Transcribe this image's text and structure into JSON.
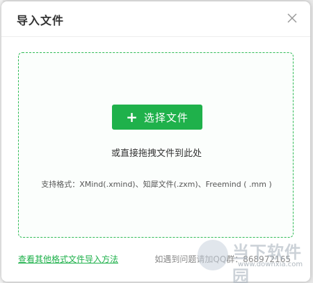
{
  "dialog": {
    "title": "导入文件",
    "close_icon": "close-icon"
  },
  "drop_zone": {
    "select_button_label": "选择文件",
    "drag_hint": "或直接拖拽文件到此处",
    "formats_text": "支持格式：XMind(.xmind)、知犀文件(.zxm)、Freemind ( .mm )"
  },
  "footer": {
    "other_formats_link": "查看其他格式文件导入方法",
    "help_text": "如遇到问题请加QQ群：868972165"
  },
  "watermark": {
    "name": "当下软件园",
    "url": "www.downxia.com"
  },
  "colors": {
    "accent": "#1fb14b",
    "border": "#2dba54"
  }
}
